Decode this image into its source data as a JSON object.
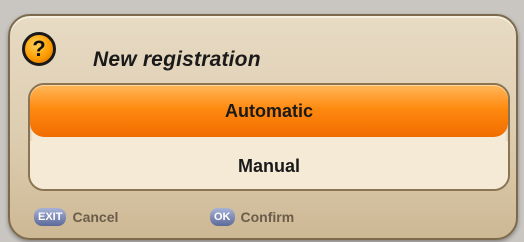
{
  "dialog": {
    "title": "New registration",
    "help_icon": "?",
    "options": [
      {
        "label": "Automatic",
        "selected": true
      },
      {
        "label": "Manual",
        "selected": false
      }
    ],
    "hints": {
      "cancel": {
        "key": "EXIT",
        "label": "Cancel"
      },
      "confirm": {
        "key": "OK",
        "label": "Confirm"
      }
    }
  },
  "colors": {
    "accent": "#ff8a10",
    "panel": "#ddcdb0"
  }
}
